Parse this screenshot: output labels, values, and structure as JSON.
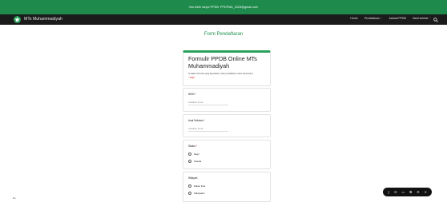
{
  "topbar": {
    "text": "Info lebih lanjut PPDB: PPDPMA_2025@gmail.com"
  },
  "nav": {
    "brand": "MTs Muhammadiyah",
    "menu": [
      {
        "label": "Home",
        "has_dropdown": false
      },
      {
        "label": "Pendaftaran",
        "has_dropdown": true
      },
      {
        "label": "Jadwal PPDB",
        "has_dropdown": false
      },
      {
        "label": "Hasil seleksi",
        "has_dropdown": true
      }
    ]
  },
  "page": {
    "title": "Form Pendaftaran"
  },
  "form": {
    "title": "Formulir PPDB Online MTs Muhammadiyah",
    "description": "Isi dalam formulir yang digunakan untuk pendaftaran calon siswa baru.",
    "required_note": "* Wajib",
    "questions": [
      {
        "label": "NISN",
        "required": true,
        "placeholder": "Jawaban Anda"
      },
      {
        "label": "Asal Sekolah",
        "required": true,
        "placeholder": "Jawaban Anda"
      },
      {
        "label": "Status",
        "required": true,
        "options": [
          "Negri",
          "Swasta"
        ]
      },
      {
        "label": "Wilayah",
        "required": false,
        "options": [
          "Dalam kota",
          "Kabupaten"
        ]
      }
    ]
  },
  "floating_toolbar": {
    "icons": [
      "phone-icon",
      "chat-icon",
      "message-icon",
      "copy-icon",
      "settings-icon",
      "close-icon"
    ]
  },
  "corner_label": "En",
  "colors": {
    "topbar": "#1e8a4c",
    "nav": "#1b1b1b",
    "accent": "#2aa15a",
    "required": "#d93025"
  }
}
